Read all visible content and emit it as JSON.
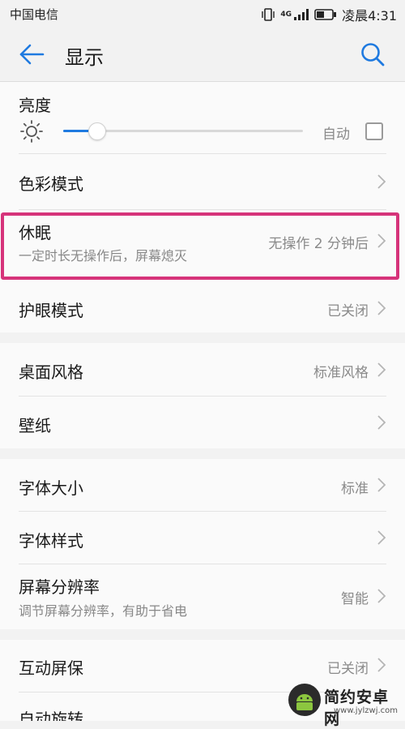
{
  "status_bar": {
    "carrier": "中国电信",
    "time": "凌晨4:31",
    "network": "4G"
  },
  "header": {
    "title": "显示",
    "back_icon": "back-arrow-icon",
    "search_icon": "search-icon"
  },
  "brightness": {
    "label": "亮度",
    "level": 0.14,
    "auto_label": "自动",
    "auto_checked": false
  },
  "rows": {
    "color_mode": {
      "label": "色彩模式"
    },
    "sleep": {
      "label": "休眠",
      "sub": "一定时长无操作后，屏幕熄灭",
      "value": "无操作 2 分钟后"
    },
    "eye_comfort": {
      "label": "护眼模式",
      "value": "已关闭"
    },
    "home_style": {
      "label": "桌面风格",
      "value": "标准风格"
    },
    "wallpaper": {
      "label": "壁纸"
    },
    "font_size": {
      "label": "字体大小",
      "value": "标准"
    },
    "font_style": {
      "label": "字体样式"
    },
    "resolution": {
      "label": "屏幕分辨率",
      "sub": "调节屏幕分辨率，有助于省电",
      "value": "智能"
    },
    "screensaver": {
      "label": "互动屏保",
      "value": "已关闭"
    },
    "auto_rotate": {
      "label": "自动旋转"
    }
  },
  "colors": {
    "accent": "#1f7ae0",
    "highlight": "#d6337a"
  },
  "watermark": {
    "name": "简约安卓网",
    "url": "www.jylzwj.com"
  }
}
